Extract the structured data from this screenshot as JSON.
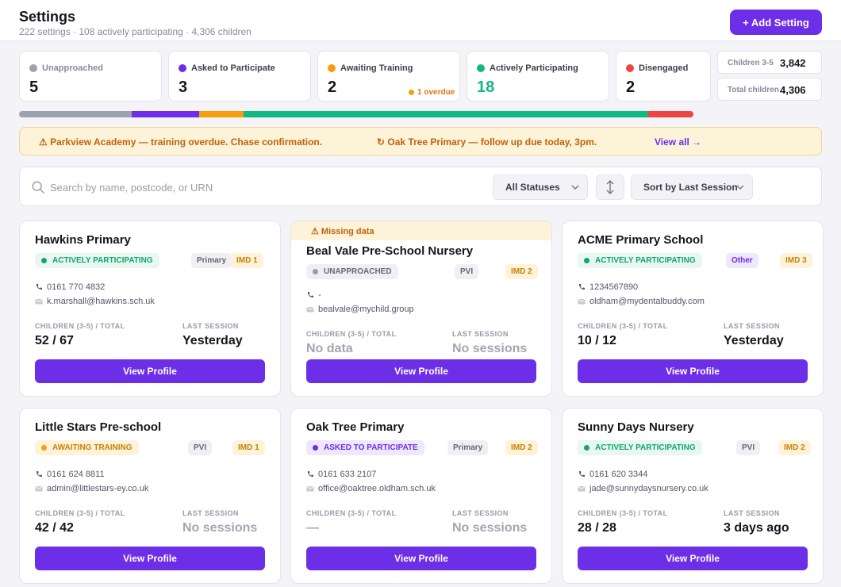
{
  "header": {
    "title": "Settings",
    "subtitle": "222 settings · 108 actively participating · 4,306 children",
    "add_button": "+ Add Setting"
  },
  "stats": [
    {
      "label": "Unapproached",
      "value": "5",
      "color": "#9ca3af"
    },
    {
      "label": "Asked to Participate",
      "value": "3",
      "color": "#6d2ee8"
    },
    {
      "label": "Awaiting Training",
      "value": "2",
      "color": "#f59e0b",
      "note": "1 overdue"
    },
    {
      "label": "Actively Participating",
      "value": "18",
      "color": "#10b981"
    },
    {
      "label": "Disengaged",
      "value": "2",
      "color": "#ef4444"
    }
  ],
  "totals": [
    {
      "label": "Children 3-5",
      "value": "3,842"
    },
    {
      "label": "Total children",
      "value": "4,306"
    }
  ],
  "alerts": {
    "items": [
      "⚠ Parkview Academy — training overdue. Chase confirmation.",
      "↻ Oak Tree Primary — follow up due today, 3pm."
    ],
    "view_all": "View all →"
  },
  "filters": {
    "search_placeholder": "Search by name, postcode, or URN",
    "status_select": "All Statuses",
    "sort_select": "Sort by Last Session"
  },
  "colors": {
    "accent": "#6d2ee8",
    "active": "#10b981",
    "awaiting": "#f59e0b",
    "disengaged": "#ef4444",
    "unapproached": "#9ca3af"
  },
  "cards": [
    {
      "name": "Hawkins Primary",
      "status": "ACTIVELY PARTICIPATING",
      "type": "Primary",
      "imd": "IMD 1",
      "phone": "0161 770 4832",
      "email": "k.marshall@hawkins.sch.uk",
      "children_label": "CHILDREN (3-5) / TOTAL",
      "children": "52 / 67",
      "session_label": "LAST SESSION",
      "last_session": "Yesterday",
      "button": "View Profile"
    },
    {
      "banner": "⚠ Missing data",
      "name": "Beal Vale Pre-School Nursery",
      "status": "UNAPPROACHED",
      "type": "PVI",
      "imd": "IMD 2",
      "phone": "-",
      "email": "bealvale@mychild.group",
      "children_label": "CHILDREN (3-5) / TOTAL",
      "children": "No data",
      "session_label": "LAST SESSION",
      "last_session": "No sessions",
      "button": "View Profile"
    },
    {
      "name": "ACME Primary School",
      "status": "ACTIVELY PARTICIPATING",
      "type": "Other",
      "imd": "IMD 3",
      "phone": "1234567890",
      "email": "oldham@mydentalbuddy.com",
      "children_label": "CHILDREN (3-5) / TOTAL",
      "children": "10 / 12",
      "session_label": "LAST SESSION",
      "last_session": "Yesterday",
      "button": "View Profile"
    },
    {
      "name": "Little Stars Pre-school",
      "status": "AWAITING TRAINING",
      "type": "PVI",
      "imd": "IMD 1",
      "phone": "0161 624 8811",
      "email": "admin@littlestars-ey.co.uk",
      "children_label": "CHILDREN (3-5) / TOTAL",
      "children": "42 / 42",
      "session_label": "LAST SESSION",
      "last_session": "No sessions",
      "button": "View Profile"
    },
    {
      "name": "Oak Tree Primary",
      "status": "ASKED TO PARTICIPATE",
      "type": "Primary",
      "imd": "IMD 2",
      "phone": "0161 633 2107",
      "email": "office@oaktree.oldham.sch.uk",
      "children_label": "CHILDREN (3-5) / TOTAL",
      "children": "—",
      "session_label": "LAST SESSION",
      "last_session": "No sessions",
      "button": "View Profile"
    },
    {
      "name": "Sunny Days Nursery",
      "status": "ACTIVELY PARTICIPATING",
      "type": "PVI",
      "imd": "IMD 2",
      "phone": "0161 620 3344",
      "email": "jade@sunnydaysnursery.co.uk",
      "children_label": "CHILDREN (3-5) / TOTAL",
      "children": "28 / 28",
      "session_label": "LAST SESSION",
      "last_session": "3 days ago",
      "button": "View Profile"
    }
  ]
}
